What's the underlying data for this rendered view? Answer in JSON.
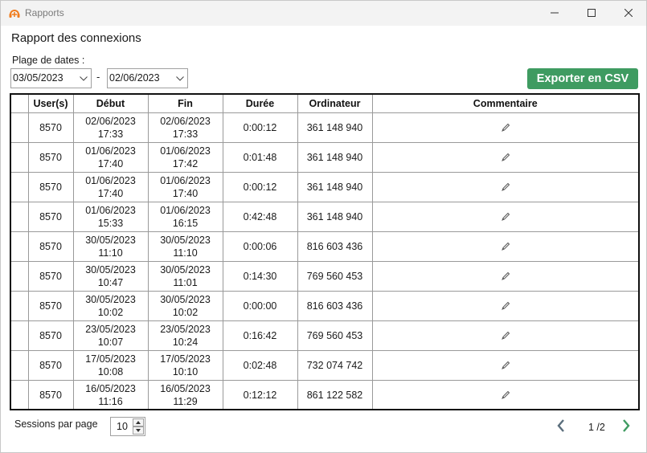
{
  "window": {
    "title": "Rapports"
  },
  "page": {
    "heading": "Rapport des connexions",
    "range_label": "Plage de dates :",
    "date_from": "03/05/2023",
    "date_to": "02/06/2023",
    "date_separator": "-",
    "export_label": "Exporter en CSV"
  },
  "colors": {
    "accent": "#3f9b61",
    "pager_arrow": "#3f9b61",
    "pager_prev_arrow": "#5a6e7c"
  },
  "icons": {
    "app": "headset-logo-icon",
    "edit": "pencil-icon",
    "prev": "chevron-left-icon",
    "next": "chevron-right-icon"
  },
  "table": {
    "columns": [
      "",
      "User(s)",
      "Début",
      "Fin",
      "Durée",
      "Ordinateur",
      "Commentaire"
    ],
    "rows": [
      {
        "user": "8570",
        "start_date": "02/06/2023",
        "start_time": "17:33",
        "end_date": "02/06/2023",
        "end_time": "17:33",
        "duration": "0:00:12",
        "computer": "361 148 940"
      },
      {
        "user": "8570",
        "start_date": "01/06/2023",
        "start_time": "17:40",
        "end_date": "01/06/2023",
        "end_time": "17:42",
        "duration": "0:01:48",
        "computer": "361 148 940"
      },
      {
        "user": "8570",
        "start_date": "01/06/2023",
        "start_time": "17:40",
        "end_date": "01/06/2023",
        "end_time": "17:40",
        "duration": "0:00:12",
        "computer": "361 148 940"
      },
      {
        "user": "8570",
        "start_date": "01/06/2023",
        "start_time": "15:33",
        "end_date": "01/06/2023",
        "end_time": "16:15",
        "duration": "0:42:48",
        "computer": "361 148 940"
      },
      {
        "user": "8570",
        "start_date": "30/05/2023",
        "start_time": "11:10",
        "end_date": "30/05/2023",
        "end_time": "11:10",
        "duration": "0:00:06",
        "computer": "816 603 436"
      },
      {
        "user": "8570",
        "start_date": "30/05/2023",
        "start_time": "10:47",
        "end_date": "30/05/2023",
        "end_time": "11:01",
        "duration": "0:14:30",
        "computer": "769 560 453"
      },
      {
        "user": "8570",
        "start_date": "30/05/2023",
        "start_time": "10:02",
        "end_date": "30/05/2023",
        "end_time": "10:02",
        "duration": "0:00:00",
        "computer": "816 603 436"
      },
      {
        "user": "8570",
        "start_date": "23/05/2023",
        "start_time": "10:07",
        "end_date": "23/05/2023",
        "end_time": "10:24",
        "duration": "0:16:42",
        "computer": "769 560 453"
      },
      {
        "user": "8570",
        "start_date": "17/05/2023",
        "start_time": "10:08",
        "end_date": "17/05/2023",
        "end_time": "10:10",
        "duration": "0:02:48",
        "computer": "732 074 742"
      },
      {
        "user": "8570",
        "start_date": "16/05/2023",
        "start_time": "11:16",
        "end_date": "16/05/2023",
        "end_time": "11:29",
        "duration": "0:12:12",
        "computer": "861 122 582"
      }
    ]
  },
  "footer": {
    "sessions_label": "Sessions par page",
    "sessions_value": "10",
    "page_indicator": "1 /2"
  }
}
